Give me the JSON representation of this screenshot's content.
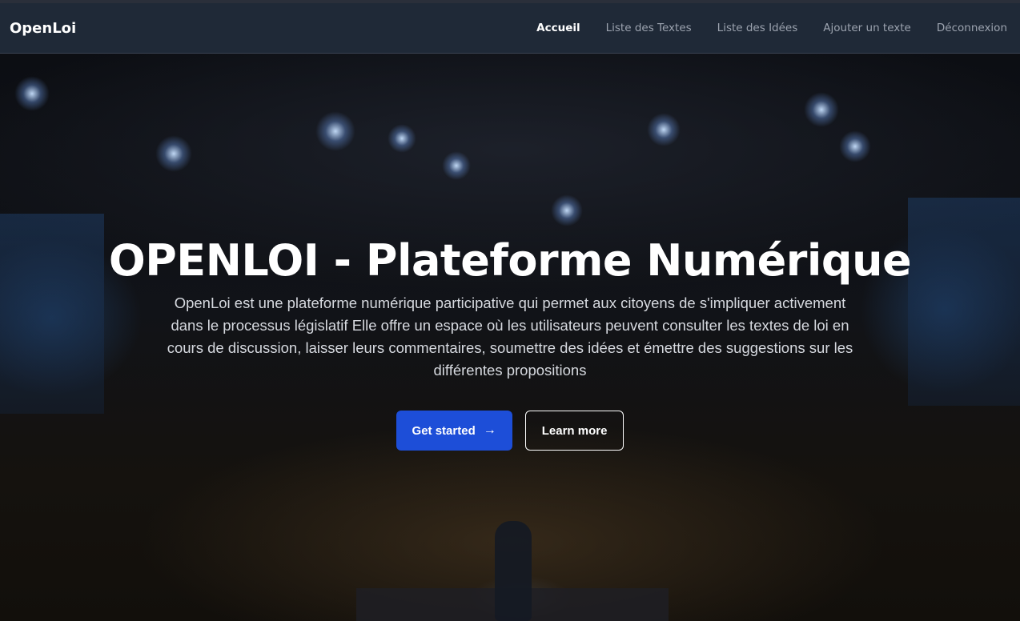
{
  "navbar": {
    "brand": "OpenLoi",
    "links": [
      {
        "label": "Accueil",
        "active": true
      },
      {
        "label": "Liste des Textes",
        "active": false
      },
      {
        "label": "Liste des Idées",
        "active": false
      },
      {
        "label": "Ajouter un texte",
        "active": false
      },
      {
        "label": "Déconnexion",
        "active": false
      }
    ]
  },
  "hero": {
    "title": "OPENLOI - Plateforme Numérique",
    "description": "OpenLoi est une plateforme numérique participative qui permet aux citoyens de s'impliquer activement dans le processus législatif Elle offre un espace où les utilisateurs peuvent consulter les textes de loi en cours de discussion, laisser leurs commentaires, soumettre des idées et émettre des suggestions sur les différentes propositions",
    "primary_button": "Get started",
    "primary_icon": "arrow-right-icon",
    "secondary_button": "Learn more"
  },
  "colors": {
    "navbar_bg": "#1f2937",
    "primary_button": "#1d4ed8",
    "text_white": "#ffffff",
    "nav_inactive": "#9ca3af"
  }
}
